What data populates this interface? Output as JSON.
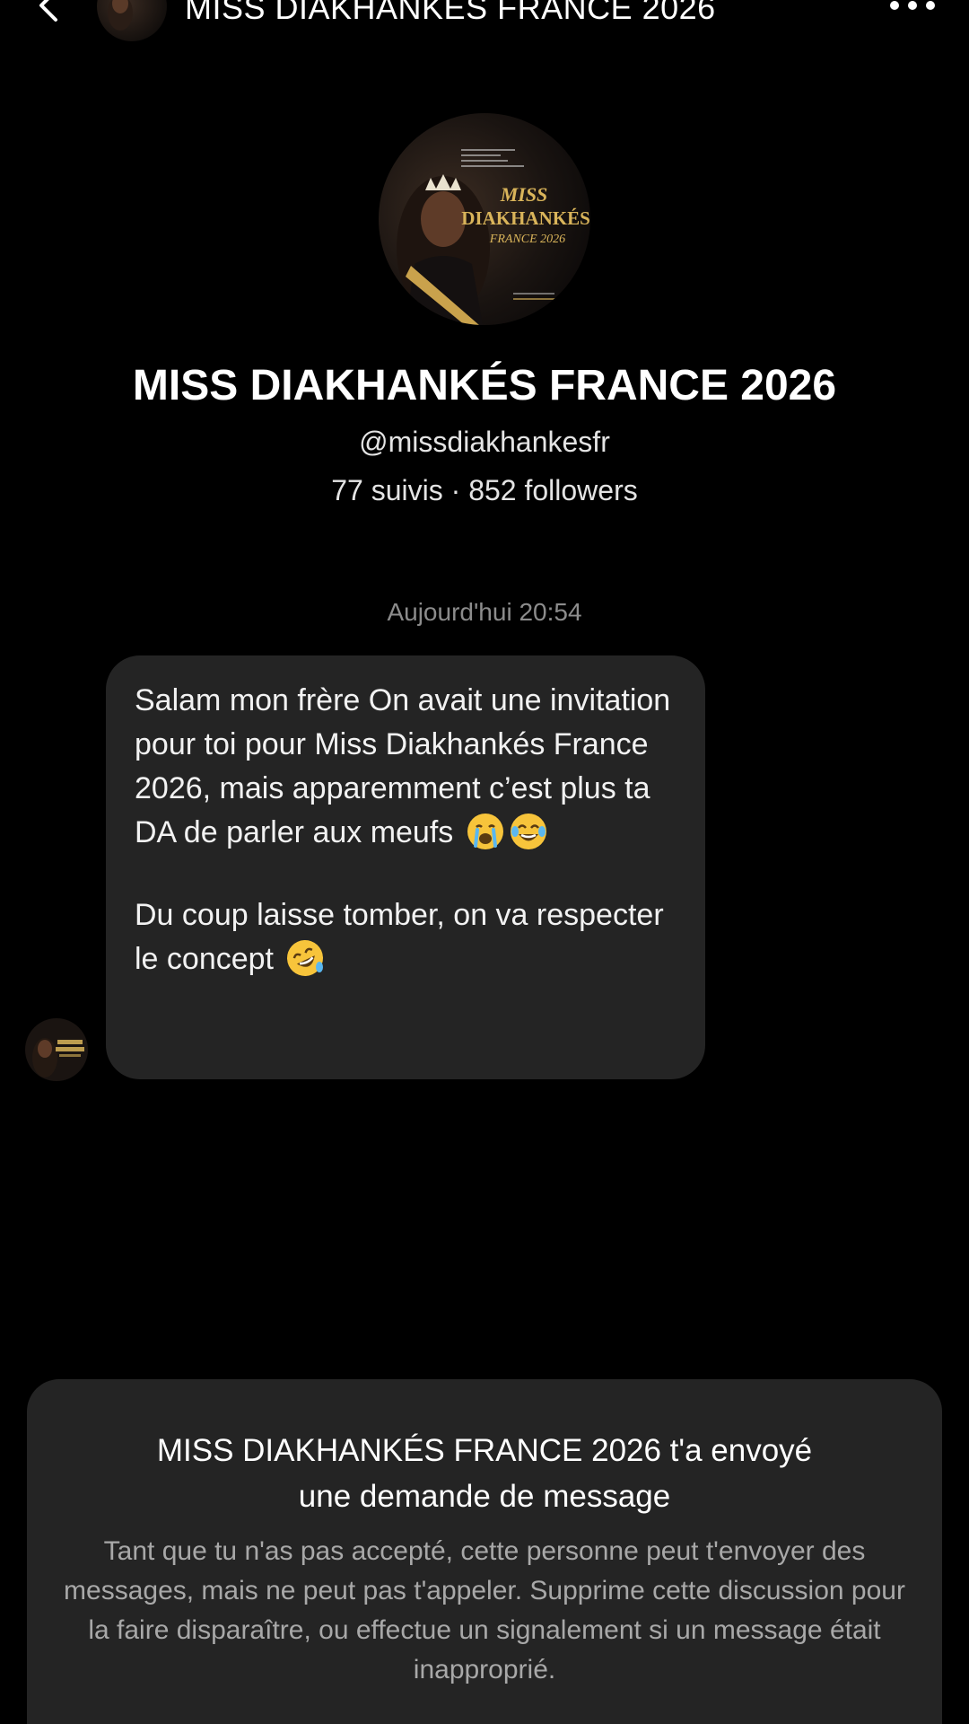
{
  "header": {
    "title": "MISS DIAKHANKÉS FRANCE 2026",
    "back_icon": "chevron-left-icon",
    "more_icon": "more-horizontal-icon"
  },
  "profile": {
    "name": "MISS DIAKHANKÉS FRANCE 2026",
    "handle": "@missdiakhankesfr",
    "stats": "77 suivis · 852 followers",
    "avatar_text": {
      "line1": "MISS",
      "line2": "DIAKHANKÉS",
      "line3": "FRANCE 2026"
    }
  },
  "conversation": {
    "timestamp": "Aujourd'hui 20:54",
    "message": {
      "paragraph1": "Salam mon frère On avait une invitation pour toi pour Miss Diakhankés France 2026, mais apparemment c’est plus ta DA de parler aux meufs",
      "paragraph1_emojis": [
        "crying-face-emoji",
        "tears-of-joy-emoji"
      ],
      "paragraph2": "Du coup laisse tomber, on va respecter le concept",
      "paragraph2_emojis": [
        "rolling-laughing-emoji"
      ]
    }
  },
  "request": {
    "title_line1": "MISS DIAKHANKÉS FRANCE 2026 t'a envoyé",
    "title_line2": "une demande de message",
    "description": "Tant que tu n'as pas accepté, cette personne peut t'envoyer des messages, mais ne peut pas t'appeler. Supprime cette discussion pour la faire disparaître, ou effectue un signalement si un message était inapproprié."
  },
  "colors": {
    "background": "#000000",
    "bubble": "#242424",
    "gold": "#d9b45a",
    "secondary_text": "#a8a8a8"
  }
}
